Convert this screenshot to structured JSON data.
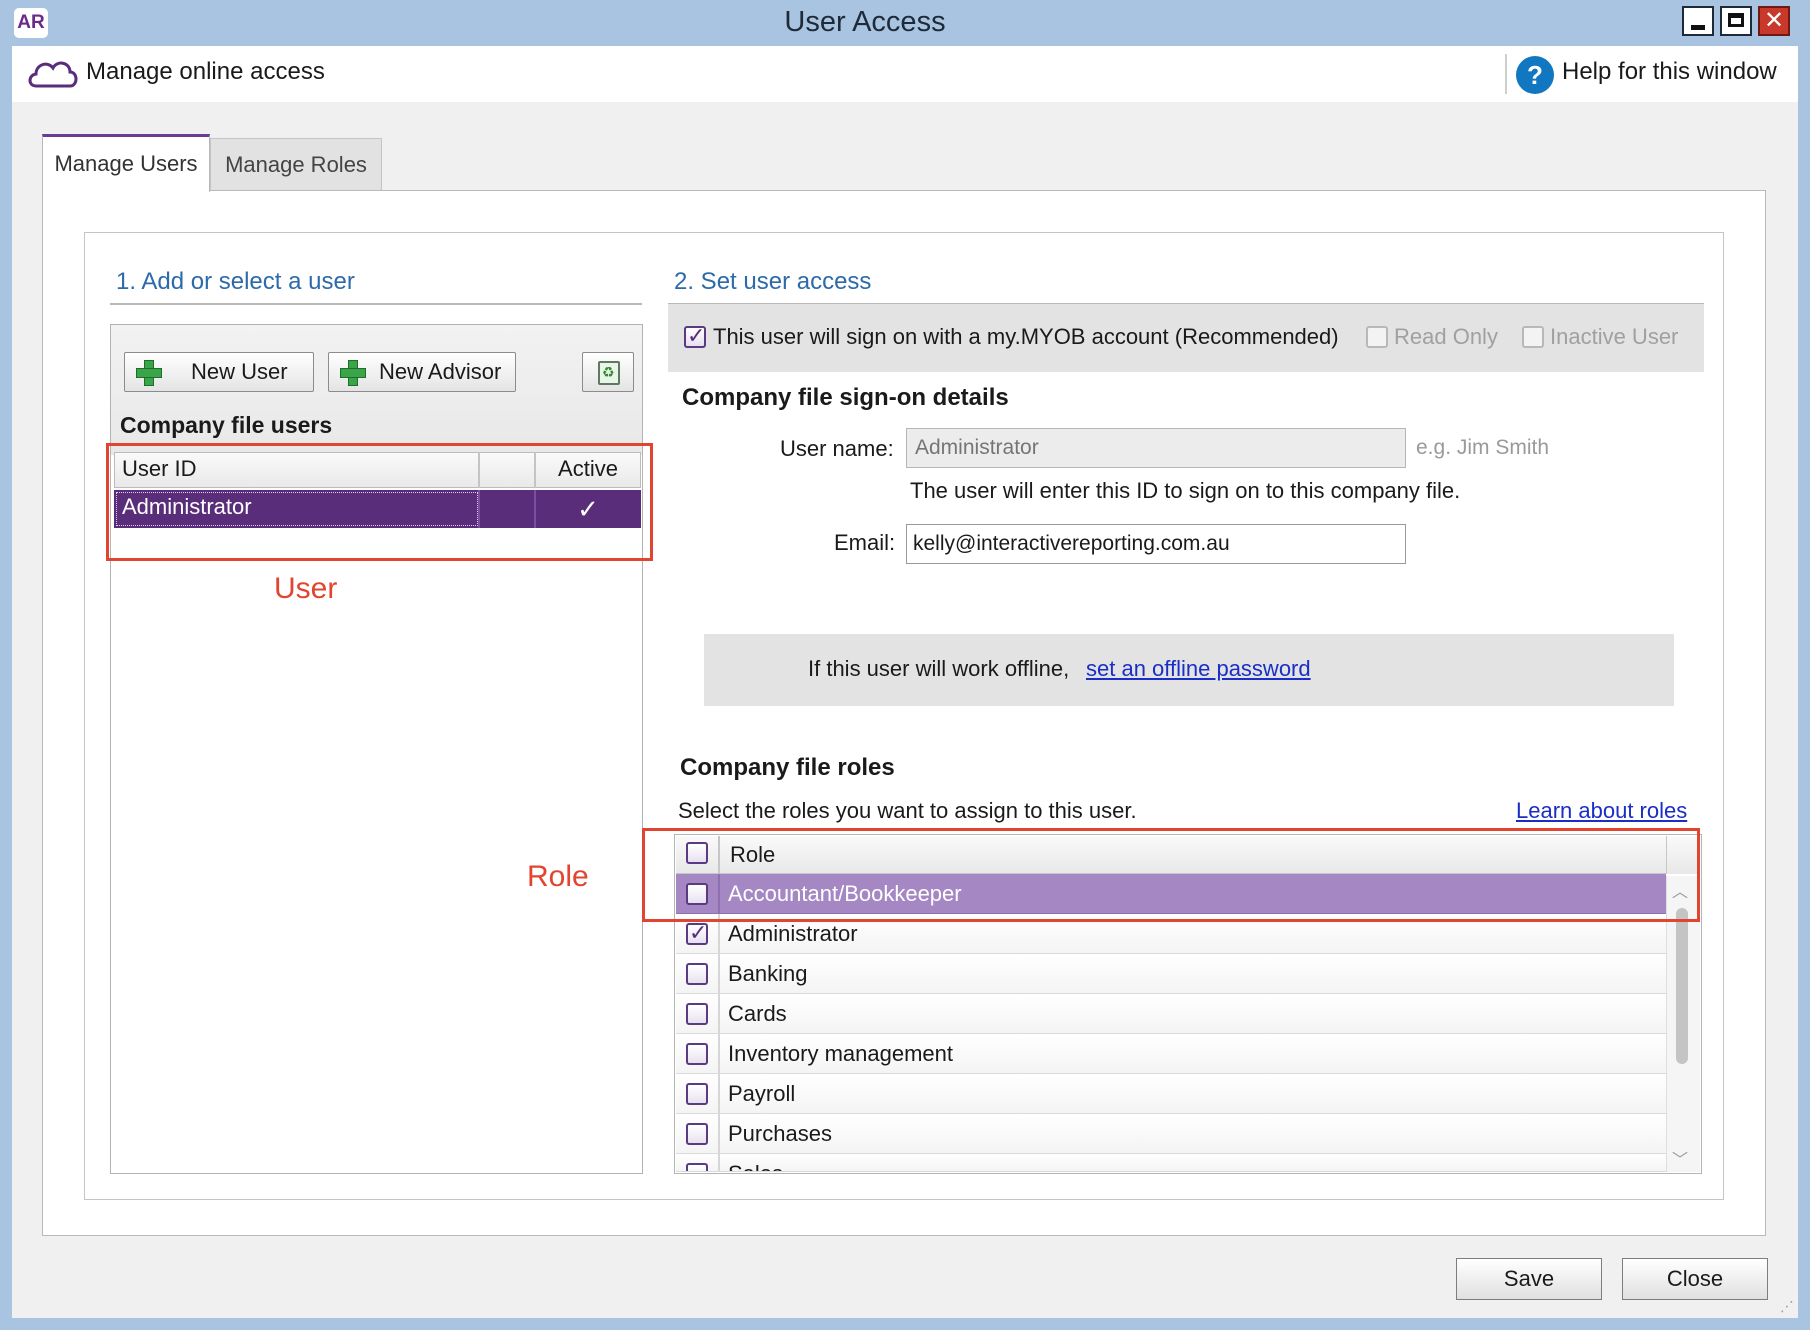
{
  "window": {
    "app_badge": "AR",
    "title": "User Access",
    "close_glyph": "✕"
  },
  "toolbar": {
    "manage_online": "Manage online access",
    "help_glyph": "?",
    "help": "Help for this window"
  },
  "tabs": [
    {
      "label": "Manage Users",
      "active": true
    },
    {
      "label": "Manage Roles",
      "active": false
    }
  ],
  "section1": {
    "heading": "1. Add or select a user",
    "buttons": {
      "new_user": "New User",
      "new_advisor": "New Advisor"
    },
    "list_label": "Company file users",
    "columns": {
      "user_id": "User ID",
      "active": "Active"
    },
    "users": [
      {
        "user_id": "Administrator",
        "active_mark": "✓",
        "selected": true
      }
    ]
  },
  "section2": {
    "heading": "2. Set user access",
    "myob_signon": "This user will sign on with a my.MYOB account (Recommended)",
    "myob_signon_checked": true,
    "read_only": "Read Only",
    "inactive_user": "Inactive User",
    "signon_heading": "Company file sign-on details",
    "username_label": "User name:",
    "username_placeholder": "Administrator",
    "username_example": "e.g. Jim Smith",
    "username_hint": "The user will enter this ID to sign on to this company file.",
    "email_label": "Email:",
    "email_value": "kelly@interactivereporting.com.au",
    "offline_text": "If this user will work offline,",
    "offline_link": "set an offline password",
    "roles_heading": "Company file roles",
    "roles_sub": "Select the roles you want to assign to this user.",
    "learn_link": "Learn about roles",
    "roles_column": "Role",
    "roles": [
      {
        "name": "Accountant/Bookkeeper",
        "checked": false,
        "selected": true
      },
      {
        "name": "Administrator",
        "checked": true,
        "selected": false
      },
      {
        "name": "Banking",
        "checked": false,
        "selected": false
      },
      {
        "name": "Cards",
        "checked": false,
        "selected": false
      },
      {
        "name": "Inventory management",
        "checked": false,
        "selected": false
      },
      {
        "name": "Payroll",
        "checked": false,
        "selected": false
      },
      {
        "name": "Purchases",
        "checked": false,
        "selected": false
      },
      {
        "name": "Sales",
        "checked": false,
        "selected": false
      }
    ]
  },
  "annotations": {
    "user": "User",
    "role": "Role",
    "color": "#e2452f"
  },
  "footer": {
    "save": "Save",
    "close": "Close"
  },
  "colors": {
    "accent": "#5a2d7a",
    "selected_role": "#a587c3",
    "link": "#1a2ec7",
    "section_heading": "#2d6aa9",
    "titlebar": "#a8c4e0"
  }
}
